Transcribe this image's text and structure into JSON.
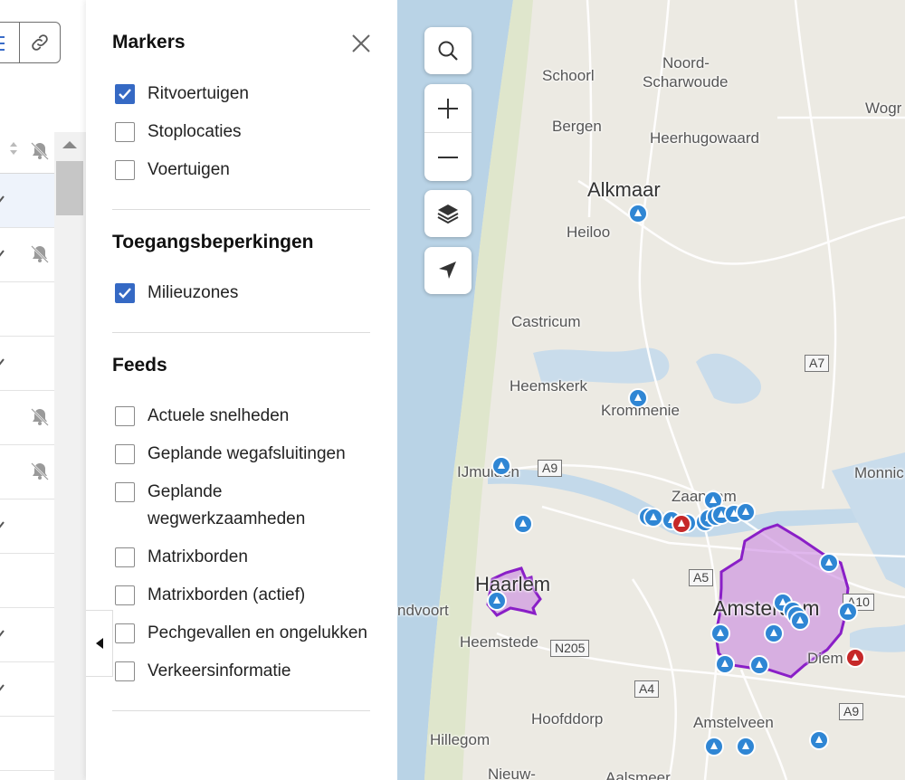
{
  "panel": {
    "markers_title": "Markers",
    "markers": [
      {
        "label": "Ritvoertuigen",
        "checked": true
      },
      {
        "label": "Stoplocaties",
        "checked": false
      },
      {
        "label": "Voertuigen",
        "checked": false
      }
    ],
    "access_title": "Toegangsbeperkingen",
    "access": [
      {
        "label": "Milieuzones",
        "checked": true
      }
    ],
    "feeds_title": "Feeds",
    "feeds": [
      {
        "label": "Actuele snelheden",
        "checked": false
      },
      {
        "label": "Geplande wegafsluitingen",
        "checked": false
      },
      {
        "label": "Geplande wegwerkzaamheden",
        "checked": false
      },
      {
        "label": "Matrixborden",
        "checked": false
      },
      {
        "label": "Matrixborden (actief)",
        "checked": false
      },
      {
        "label": "Pechgevallen en ongelukken",
        "checked": false
      },
      {
        "label": "Verkeersinformatie",
        "checked": false
      }
    ]
  },
  "map": {
    "places": {
      "schoorl": "Schoorl",
      "noord_scharwoude_1": "Noord-",
      "noord_scharwoude_2": "Scharwoude",
      "wogn": "Wogr",
      "bergen": "Bergen",
      "heerhugowaard": "Heerhugowaard",
      "alkmaar": "Alkmaar",
      "heiloo": "Heiloo",
      "castricum": "Castricum",
      "heemskerk": "Heemskerk",
      "krommenie": "Krommenie",
      "ijmuiden": "IJmuiden",
      "monnic": "Monnic",
      "zaandam": "Zaandam",
      "haarlem": "Haarlem",
      "zandvoort": "ndvoort",
      "heemstede": "Heemstede",
      "amsterdam": "Amsterdam",
      "diemen": "Diem",
      "hoofddorp": "Hoofddorp",
      "amstelveen": "Amstelveen",
      "hillegom": "Hillegom",
      "nieuw": "Nieuw-",
      "aalsmeer": "Aalsmeer"
    },
    "roads": {
      "a7": "A7",
      "a9_top": "A9",
      "a5": "A5",
      "n205": "N205",
      "a4": "A4",
      "a9_bottom": "A9",
      "a10": "A10"
    },
    "colors": {
      "vehicle_marker": "#2f86d4",
      "alert_marker": "#c62828",
      "zone_fill": "#c77de0",
      "zone_stroke": "#8a1fc7"
    }
  }
}
